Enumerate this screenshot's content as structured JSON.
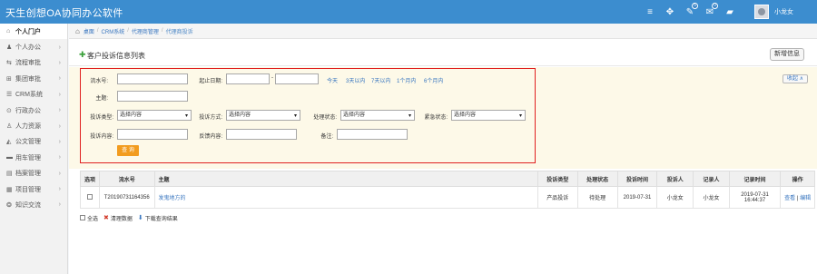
{
  "app": {
    "title": "天生创想OA协同办公软件",
    "username": "小龙女",
    "header_icons": [
      {
        "icon": "menu-icon",
        "glyph": "≡"
      },
      {
        "icon": "expand-icon",
        "glyph": "✥"
      },
      {
        "icon": "chat-icon",
        "glyph": "💬",
        "badge": "5"
      },
      {
        "icon": "mail-icon",
        "glyph": "✉",
        "badge": "0"
      },
      {
        "icon": "message-icon",
        "glyph": "▰"
      }
    ]
  },
  "sidebar": {
    "items": [
      {
        "label": "个人门户",
        "icon": "home-icon",
        "glyph": "⌂"
      },
      {
        "label": "个人办公",
        "icon": "user-icon",
        "glyph": "♟"
      },
      {
        "label": "流程审批",
        "icon": "flow-icon",
        "glyph": "⇆"
      },
      {
        "label": "集团审批",
        "icon": "group-icon",
        "glyph": "⊞"
      },
      {
        "label": "CRM系统",
        "icon": "crm-icon",
        "glyph": "☰"
      },
      {
        "label": "行政办公",
        "icon": "admin-icon",
        "glyph": "⊙"
      },
      {
        "label": "人力资源",
        "icon": "hr-icon",
        "glyph": "♙"
      },
      {
        "label": "公文管理",
        "icon": "document-icon",
        "glyph": "◭"
      },
      {
        "label": "用车管理",
        "icon": "car-icon",
        "glyph": "▬"
      },
      {
        "label": "档案管理",
        "icon": "archive-icon",
        "glyph": "▤"
      },
      {
        "label": "项目管理",
        "icon": "project-icon",
        "glyph": "▦"
      },
      {
        "label": "知识交流",
        "icon": "knowledge-icon",
        "glyph": "❂"
      }
    ]
  },
  "breadcrumb": [
    "桌面",
    "CRM系统",
    "代理商管理",
    "代理商投诉"
  ],
  "page": {
    "title": "客户投诉信息列表",
    "new_button": "新增信息",
    "collapse_button": "收起 ∧"
  },
  "filters": {
    "serial_label": "流水号:",
    "date_label": "起止日期:",
    "date_sep": "-",
    "quick_dates": [
      "今天",
      "3天以内",
      "7天以内",
      "1个月内",
      "6个月内"
    ],
    "subject_label": "主题:",
    "complaint_type_label": "投诉类型:",
    "complaint_type_value": "选择内容",
    "complaint_method_label": "投诉方式:",
    "complaint_method_value": "选择内容",
    "process_status_label": "处理状态:",
    "process_status_value": "选择内容",
    "urgency_label": "紧急状态:",
    "urgency_value": "选择内容",
    "content_label": "投诉内容:",
    "feedback_label": "反馈内容:",
    "remark_label": "备注:",
    "search_button": "查 询"
  },
  "table": {
    "headers": [
      "选项",
      "流水号",
      "主题",
      "投诉类型",
      "处理状态",
      "投诉时间",
      "投诉人",
      "记录人",
      "记录时间",
      "操作"
    ],
    "rows": [
      {
        "serial": "T20190731164356",
        "subject": "发鬼地方的",
        "type": "产品投诉",
        "status": "待处理",
        "complaint_time": "2019-07-31",
        "complainant": "小龙女",
        "recorder": "小龙女",
        "record_date": "2019-07-31",
        "record_clock": "16:44:37",
        "view": "查看",
        "op_sep": "|",
        "edit": "编辑"
      }
    ]
  },
  "footer": {
    "select_all": "全选",
    "clear_data": "清理数据",
    "download": "下载查询结果"
  }
}
